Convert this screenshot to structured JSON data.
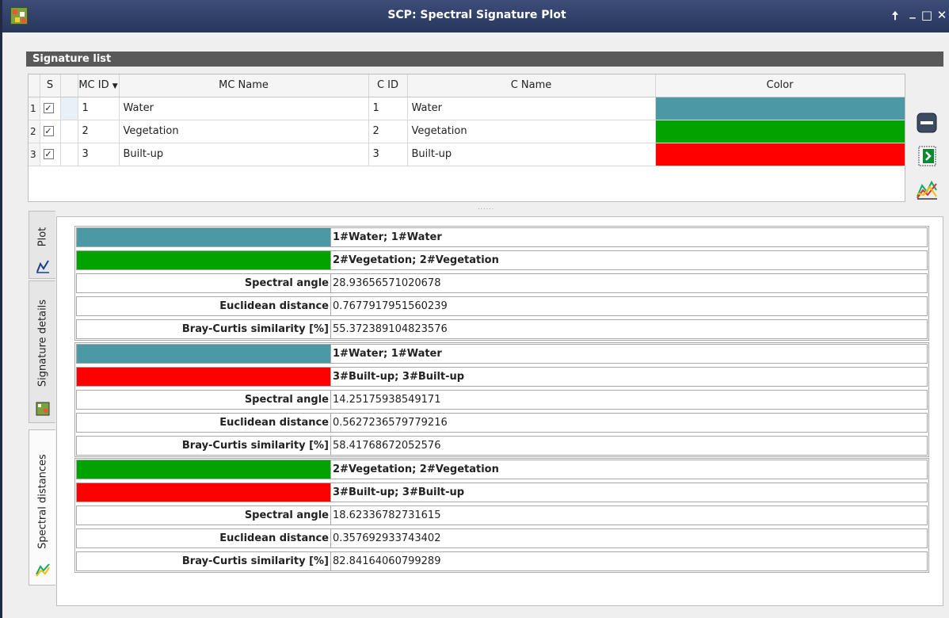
{
  "window": {
    "title": "SCP: Spectral Signature Plot",
    "controls": {
      "pin": "🠅",
      "minimize": "_",
      "maximize": "□",
      "close": "✕"
    }
  },
  "signature_list": {
    "header": "Signature list",
    "columns": [
      "S",
      "MC ID",
      "MC Name",
      "C ID",
      "C Name",
      "Color"
    ],
    "rows": [
      {
        "num": "1",
        "checked": "✓",
        "mc_id": "1",
        "mc_name": "Water",
        "c_id": "1",
        "c_name": "Water",
        "color": "#4a99a5"
      },
      {
        "num": "2",
        "checked": "✓",
        "mc_id": "2",
        "mc_name": "Vegetation",
        "c_id": "2",
        "c_name": "Vegetation",
        "color": "#00a300"
      },
      {
        "num": "3",
        "checked": "✓",
        "mc_id": "3",
        "mc_name": "Built-up",
        "c_id": "3",
        "c_name": "Built-up",
        "color": "#ff0000"
      }
    ]
  },
  "side_tools": [
    "remove-signature-icon",
    "import-signature-icon",
    "spectral-plot-icon"
  ],
  "tabs": [
    {
      "label": "Plot",
      "icon": "plot-icon"
    },
    {
      "label": "Signature details",
      "icon": "signature-details-icon"
    },
    {
      "label": "Spectral distances",
      "icon": "spectral-distances-icon",
      "active": true
    }
  ],
  "distances": [
    {
      "sig_a": {
        "label": "1#Water; 1#Water",
        "color": "#4a99a5"
      },
      "sig_b": {
        "label": "2#Vegetation; 2#Vegetation",
        "color": "#00a300"
      },
      "metrics": [
        {
          "name": "Spectral angle",
          "value": "28.93656571020678"
        },
        {
          "name": "Euclidean distance",
          "value": "0.7677917951560239"
        },
        {
          "name": "Bray-Curtis similarity [%]",
          "value": "55.372389104823576"
        }
      ]
    },
    {
      "sig_a": {
        "label": "1#Water; 1#Water",
        "color": "#4a99a5"
      },
      "sig_b": {
        "label": "3#Built-up; 3#Built-up",
        "color": "#ff0000"
      },
      "metrics": [
        {
          "name": "Spectral angle",
          "value": "14.25175938549171"
        },
        {
          "name": "Euclidean distance",
          "value": "0.5627236579779216"
        },
        {
          "name": "Bray-Curtis similarity [%]",
          "value": "58.41768672052576"
        }
      ]
    },
    {
      "sig_a": {
        "label": "2#Vegetation; 2#Vegetation",
        "color": "#00a300"
      },
      "sig_b": {
        "label": "3#Built-up; 3#Built-up",
        "color": "#ff0000"
      },
      "metrics": [
        {
          "name": "Spectral angle",
          "value": "18.62336782731615"
        },
        {
          "name": "Euclidean distance",
          "value": "0.357692933743402"
        },
        {
          "name": "Bray-Curtis similarity [%]",
          "value": "82.84164060799289"
        }
      ]
    }
  ]
}
